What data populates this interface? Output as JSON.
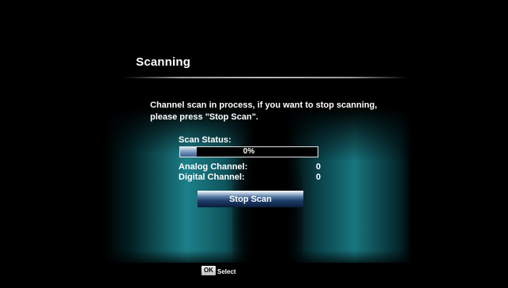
{
  "dialog": {
    "title": "Scanning",
    "message": "Channel scan in process, if you want to stop scanning, please press \"Stop Scan\"."
  },
  "scan_status": {
    "label": "Scan Status:",
    "progress_text": "0%",
    "progress_fraction": 0.12
  },
  "channels": {
    "analog_label": "Analog Channel:",
    "analog_count": "0",
    "digital_label": "Digital Channel:",
    "digital_count": "0"
  },
  "stop_button": {
    "label": "Stop Scan"
  },
  "footer": {
    "ok_key": "OK",
    "ok_label": "Select"
  },
  "colors": {
    "background": "#000000",
    "glow": "#1e8791",
    "button_dark": "#0a1d3a",
    "progress_fill": "#6d8fb6"
  }
}
